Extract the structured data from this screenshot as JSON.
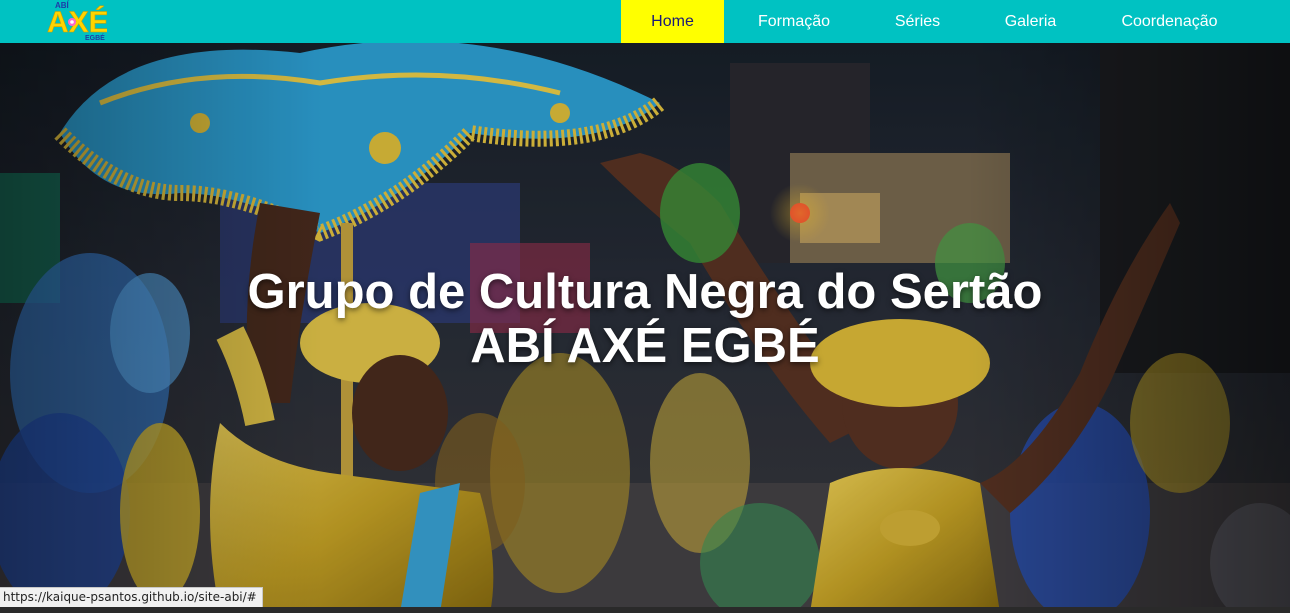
{
  "logo": {
    "top_text": "ABÍ",
    "main_text": "AXÉ",
    "sub_text": "EGBÉ"
  },
  "nav": {
    "items": [
      {
        "label": "Home",
        "active": true
      },
      {
        "label": "Formação",
        "active": false
      },
      {
        "label": "Séries",
        "active": false
      },
      {
        "label": "Galeria",
        "active": false
      },
      {
        "label": "Coordenação",
        "active": false
      }
    ]
  },
  "hero": {
    "title_line1": "Grupo de Cultura Negra do Sertão",
    "title_line2": "ABÍ AXÉ EGBÉ"
  },
  "status_bar": {
    "url": "https://kaique-psantos.github.io/site-abi/#"
  },
  "colors": {
    "navbar": "#00c2c2",
    "nav_active": "#ffff00",
    "nav_text": "#ffffff",
    "nav_active_text": "#1a1a7a"
  }
}
